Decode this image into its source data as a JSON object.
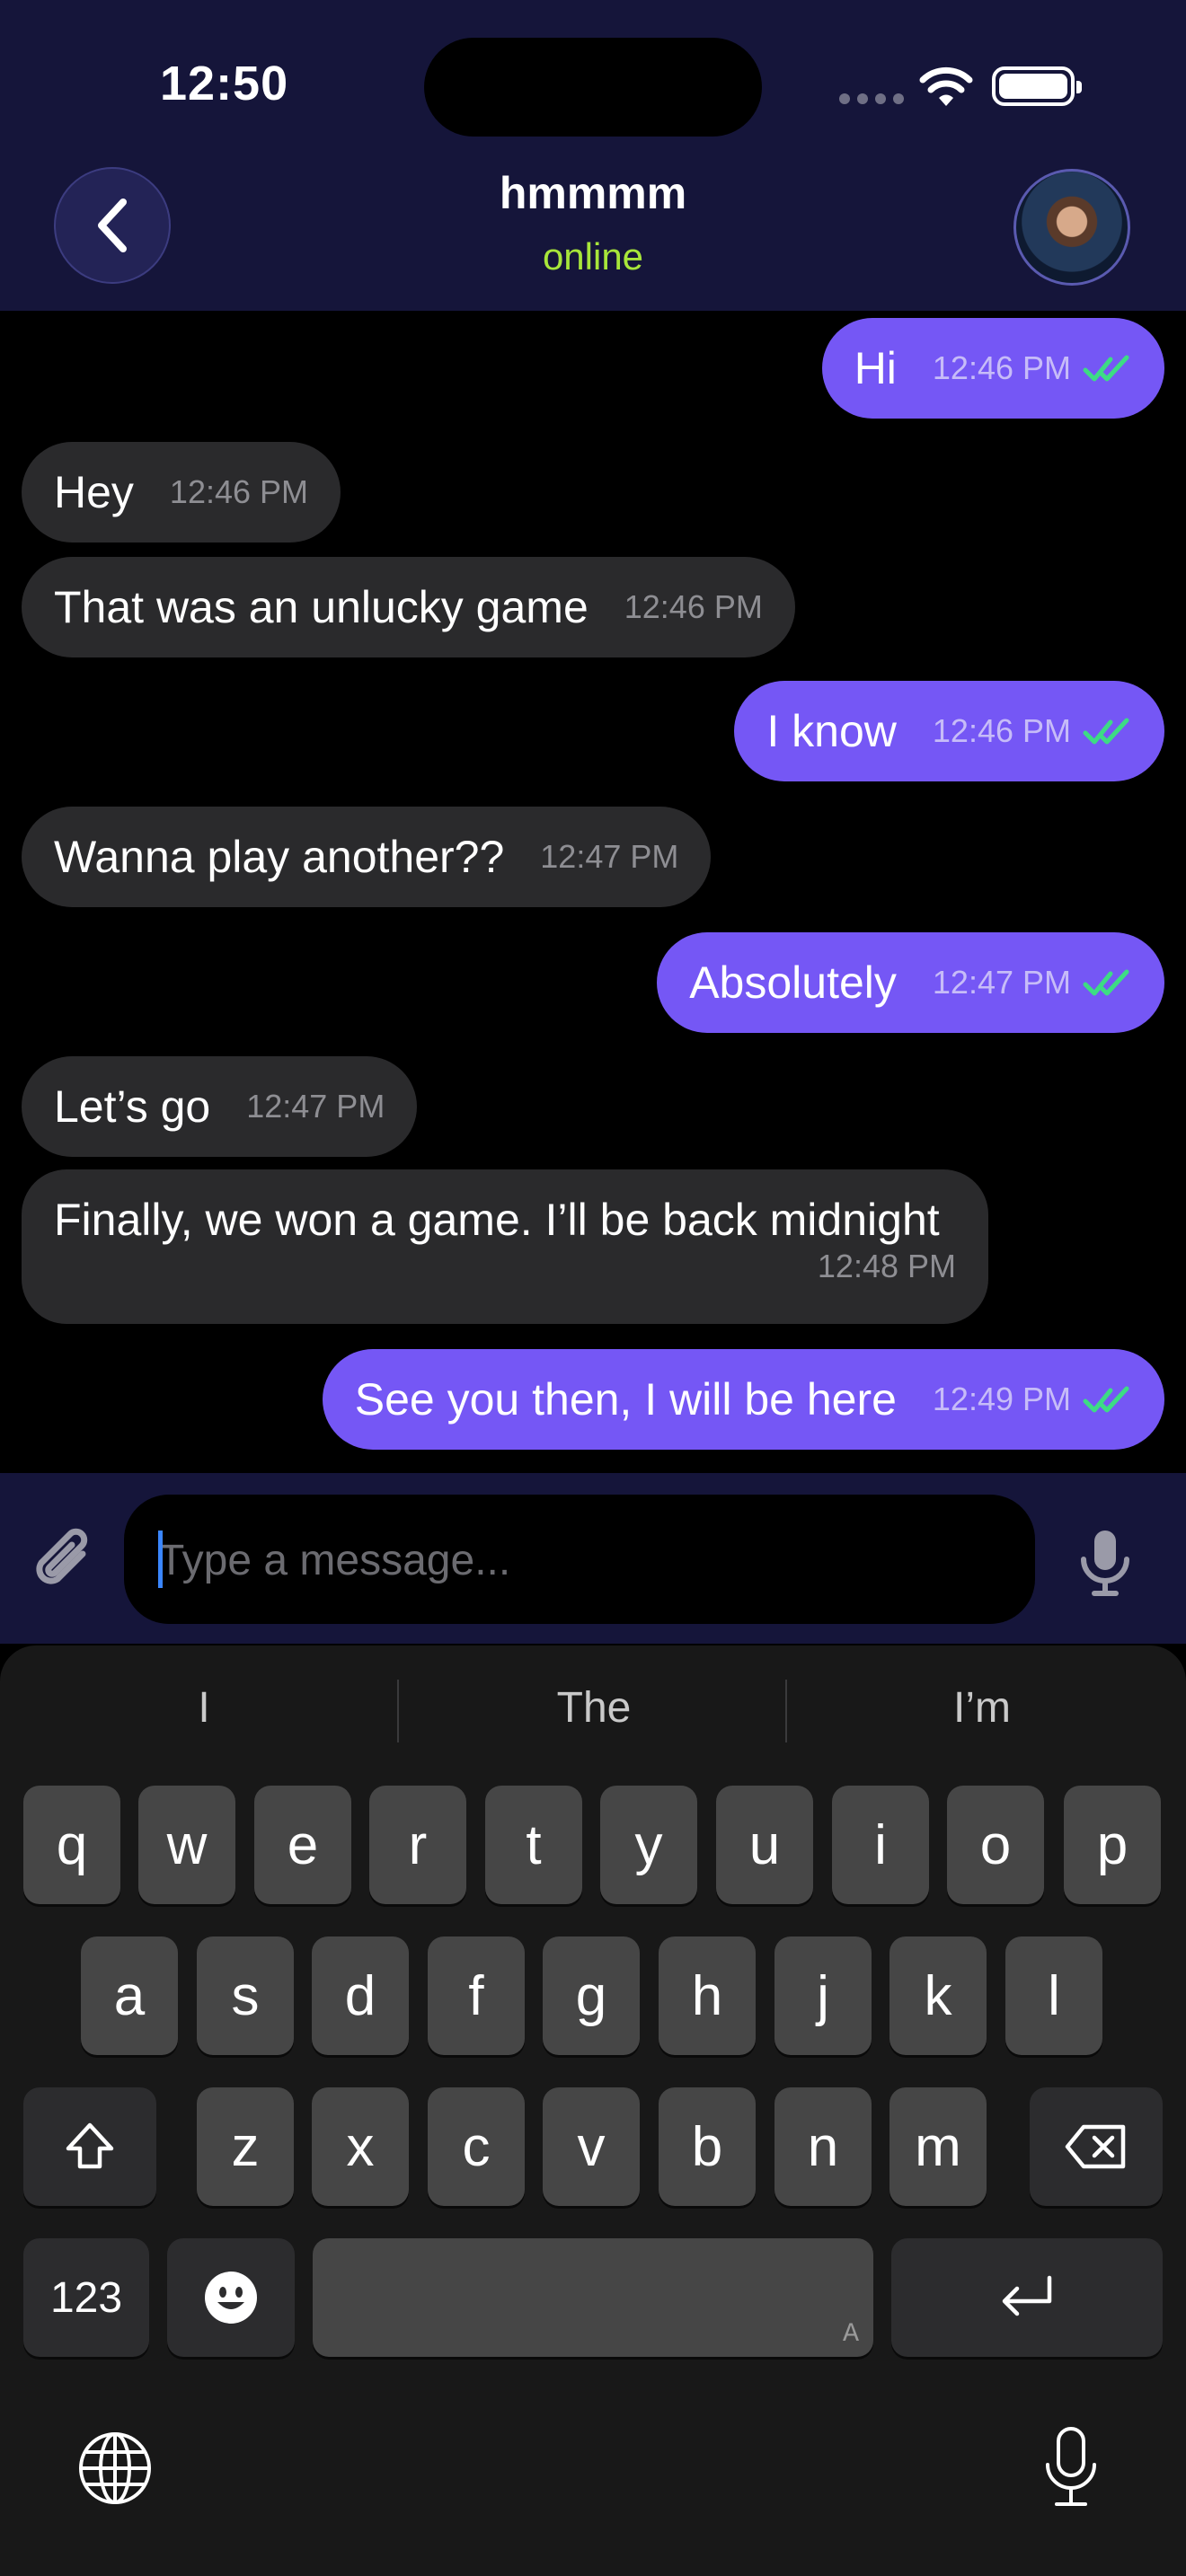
{
  "status_bar": {
    "time": "12:50"
  },
  "header": {
    "name": "hmmmm",
    "status": "online"
  },
  "messages": [
    {
      "dir": "out",
      "text": "Hi",
      "time": "12:46 PM"
    },
    {
      "dir": "in",
      "text": "Hey",
      "time": "12:46 PM"
    },
    {
      "dir": "in",
      "text": "That was an unlucky game",
      "time": "12:46 PM"
    },
    {
      "dir": "out",
      "text": "I know",
      "time": "12:46 PM"
    },
    {
      "dir": "in",
      "text": "Wanna play another??",
      "time": "12:47 PM"
    },
    {
      "dir": "out",
      "text": "Absolutely",
      "time": "12:47 PM"
    },
    {
      "dir": "in",
      "text": "Let’s go",
      "time": "12:47 PM"
    },
    {
      "dir": "in",
      "text": "Finally, we won a game. I’ll be back midnight",
      "time": "12:48 PM"
    },
    {
      "dir": "out",
      "text": "See you then, I will be here",
      "time": "12:49 PM"
    }
  ],
  "composer": {
    "placeholder": "Type a message..."
  },
  "keyboard": {
    "suggestions": [
      "I",
      "The",
      "I’m"
    ],
    "row1": [
      "q",
      "w",
      "e",
      "r",
      "t",
      "y",
      "u",
      "i",
      "o",
      "p"
    ],
    "row2": [
      "a",
      "s",
      "d",
      "f",
      "g",
      "h",
      "j",
      "k",
      "l"
    ],
    "row3": [
      "z",
      "x",
      "c",
      "v",
      "b",
      "n",
      "m"
    ],
    "numbers_label": "123",
    "space_hint": "A"
  },
  "colors": {
    "header_bg": "#15153a",
    "outgoing_bubble": "#7557f5",
    "incoming_bubble": "#2a2a2c",
    "online": "#a8e63a",
    "read_ticks": "#3ddc84"
  }
}
